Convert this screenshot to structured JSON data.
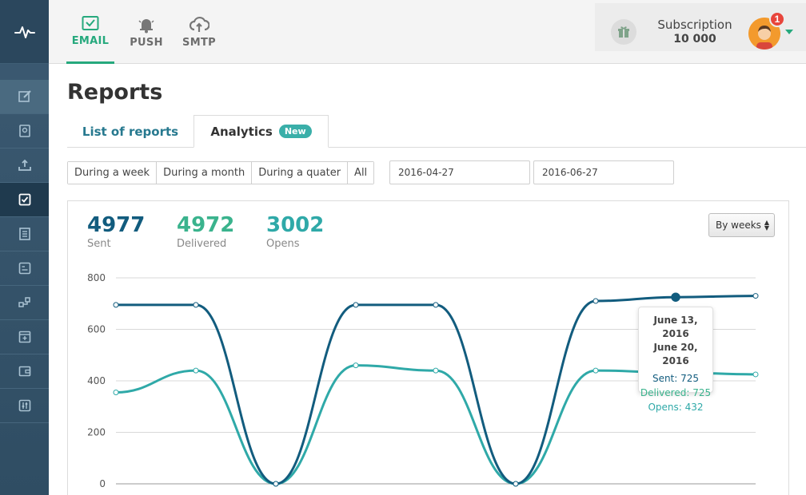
{
  "header": {
    "channels": [
      {
        "label": "EMAIL",
        "icon": "envelope-check-icon",
        "active": true
      },
      {
        "label": "PUSH",
        "icon": "bell-icon",
        "active": false
      },
      {
        "label": "SMTP",
        "icon": "cloud-upload-icon",
        "active": false
      }
    ],
    "subscription_title": "Subscription",
    "subscription_count": "10 000",
    "notification_count": "1"
  },
  "sidebar": {
    "items": [
      {
        "icon": "edit-icon"
      },
      {
        "icon": "contacts-book-icon"
      },
      {
        "icon": "upload-tray-icon"
      },
      {
        "icon": "checkbox-icon",
        "active": true
      },
      {
        "icon": "list-icon"
      },
      {
        "icon": "template-icon"
      },
      {
        "icon": "automation-icon"
      },
      {
        "icon": "add-window-icon"
      },
      {
        "icon": "wallet-icon"
      },
      {
        "icon": "sliders-icon"
      }
    ]
  },
  "page": {
    "title": "Reports",
    "tabs": {
      "list": "List of reports",
      "analytics": "Analytics",
      "new_badge": "New"
    },
    "filters": [
      "During a week",
      "During a month",
      "During a quater",
      "All"
    ],
    "date_from": "2016-04-27",
    "date_to": "2016-06-27",
    "select_value": "By weeks"
  },
  "stats": {
    "sent": {
      "value": "4977",
      "label": "Sent"
    },
    "delivered": {
      "value": "4972",
      "label": "Delivered"
    },
    "opens": {
      "value": "3002",
      "label": "Opens"
    }
  },
  "colors": {
    "sent": "#125c7e",
    "delivered": "#3ab38d",
    "opens": "#2fa9a8",
    "accent": "#26a97d"
  },
  "tooltip": {
    "date1": "June 13, 2016",
    "date2": "June 20, 2016",
    "sent": "Sent: 725",
    "delivered": "Delivered: 725",
    "opens": "Opens: 432"
  },
  "chart_data": {
    "type": "line",
    "ylim": [
      0,
      800
    ],
    "yticks": [
      "800",
      "600",
      "400",
      "200",
      "0"
    ],
    "x": [
      0,
      1,
      2,
      3,
      4,
      5,
      6,
      7,
      8
    ],
    "series": [
      {
        "name": "Sent",
        "values": [
          695,
          695,
          0,
          695,
          695,
          0,
          710,
          725,
          730
        ]
      },
      {
        "name": "Opens",
        "values": [
          355,
          440,
          0,
          460,
          440,
          0,
          440,
          432,
          425
        ]
      }
    ]
  }
}
